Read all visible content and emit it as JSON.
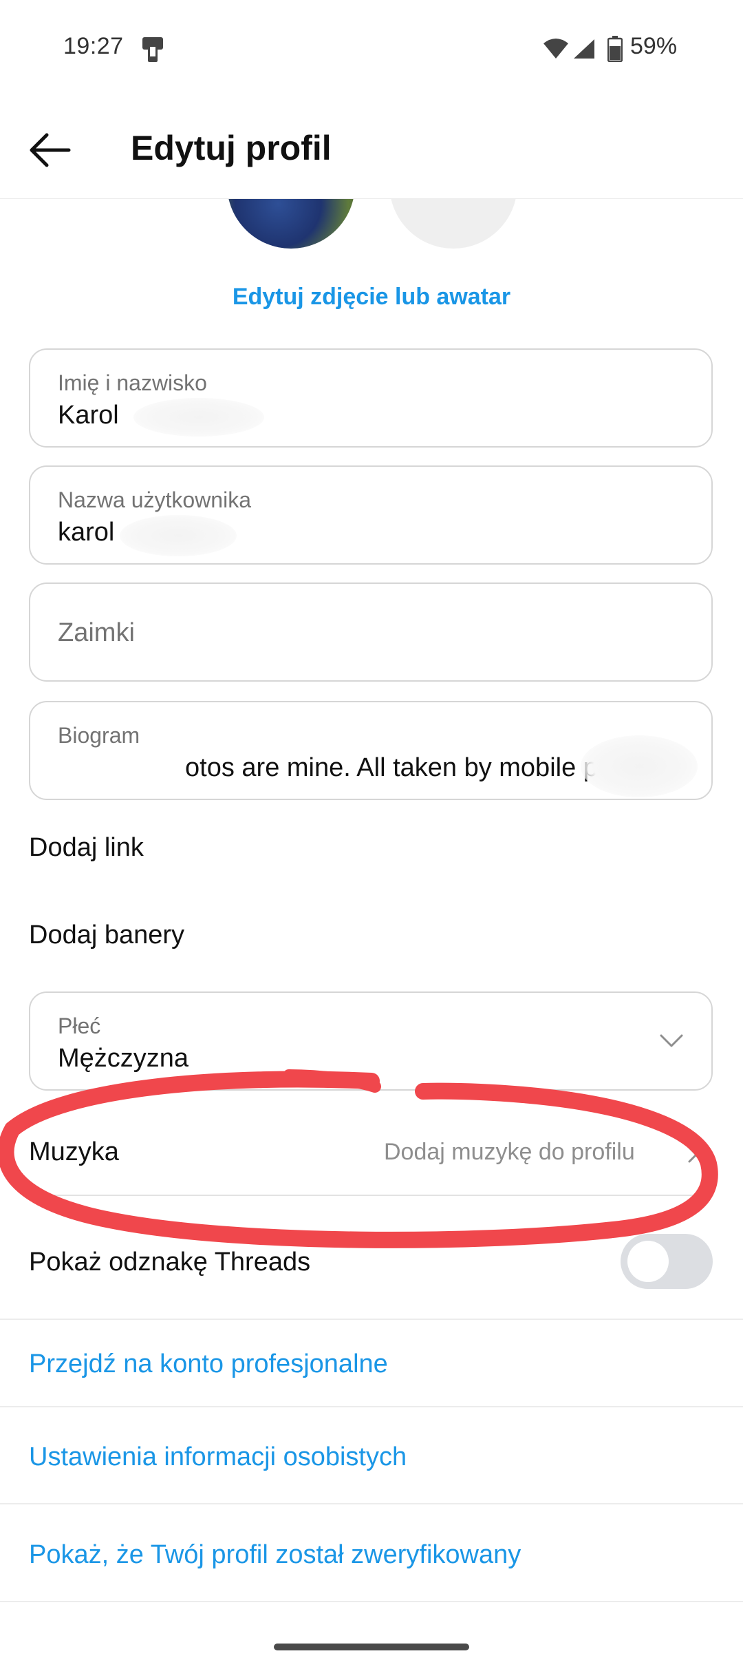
{
  "status_bar": {
    "time": "19:27",
    "battery": "59%",
    "icons": [
      "phone-icon",
      "wifi-icon",
      "signal-icon",
      "battery-icon"
    ]
  },
  "header": {
    "title": "Edytuj profil",
    "back_icon": "arrow-left-icon"
  },
  "profile": {
    "edit_photo_label": "Edytuj zdjęcie lub awatar"
  },
  "fields": {
    "name": {
      "label": "Imię i nazwisko",
      "value": "Karol"
    },
    "username": {
      "label": "Nazwa użytkownika",
      "value": "karol"
    },
    "pronouns": {
      "placeholder": "Zaimki"
    },
    "bio": {
      "label": "Biogram",
      "value": "otos are mine. All taken by mobile phone."
    },
    "gender": {
      "label": "Płeć",
      "value": "Mężczyzna"
    }
  },
  "rows": {
    "add_link": "Dodaj link",
    "add_banners": "Dodaj banery",
    "music_label": "Muzyka",
    "music_hint": "Dodaj muzykę do profilu",
    "threads_badge": "Pokaż odznakę Threads"
  },
  "toggle_threads_on": false,
  "links": {
    "professional": "Przejdź na konto profesjonalne",
    "personal_info": "Ustawienia informacji osobistych",
    "verified": "Pokaż, że Twój profil został zweryfikowany"
  },
  "colors": {
    "accent": "#1a96e6",
    "annotation": "#f0474c",
    "field_border": "#d6d6d6",
    "toggle_off": "#dcdee2"
  }
}
